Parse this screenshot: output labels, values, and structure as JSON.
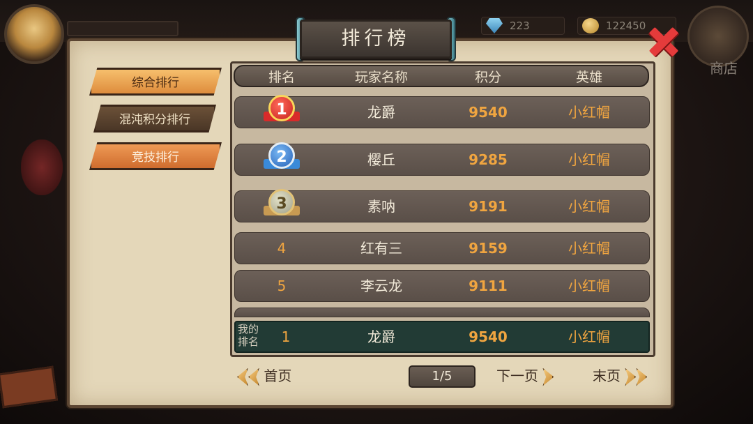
{
  "hud": {
    "diamonds": "223",
    "coins": "122450",
    "shop_label": "商店"
  },
  "title": "排行榜",
  "tabs": [
    {
      "label": "综合排行",
      "active": true
    },
    {
      "label": "混沌积分排行",
      "active": false
    },
    {
      "label": "竞技排行",
      "active": false
    }
  ],
  "table": {
    "headers": {
      "rank": "排名",
      "name": "玩家名称",
      "score": "积分",
      "hero": "英雄"
    },
    "rows": [
      {
        "rank": "1",
        "name": "龙爵",
        "score": "9540",
        "hero": "小红帽"
      },
      {
        "rank": "2",
        "name": "樱丘",
        "score": "9285",
        "hero": "小红帽"
      },
      {
        "rank": "3",
        "name": "素呐",
        "score": "9191",
        "hero": "小红帽"
      },
      {
        "rank": "4",
        "name": "红有三",
        "score": "9159",
        "hero": "小红帽"
      },
      {
        "rank": "5",
        "name": "李云龙",
        "score": "9111",
        "hero": "小红帽"
      }
    ],
    "mine": {
      "label": "我的排名",
      "rank": "1",
      "name": "龙爵",
      "score": "9540",
      "hero": "小红帽"
    }
  },
  "pager": {
    "first": "首页",
    "current": "1/5",
    "next": "下一页",
    "last": "末页"
  },
  "colors": {
    "accent": "#f0a540",
    "panel": "#e4d7b9",
    "row": "#5a4f48",
    "mine_row": "#223b35"
  }
}
